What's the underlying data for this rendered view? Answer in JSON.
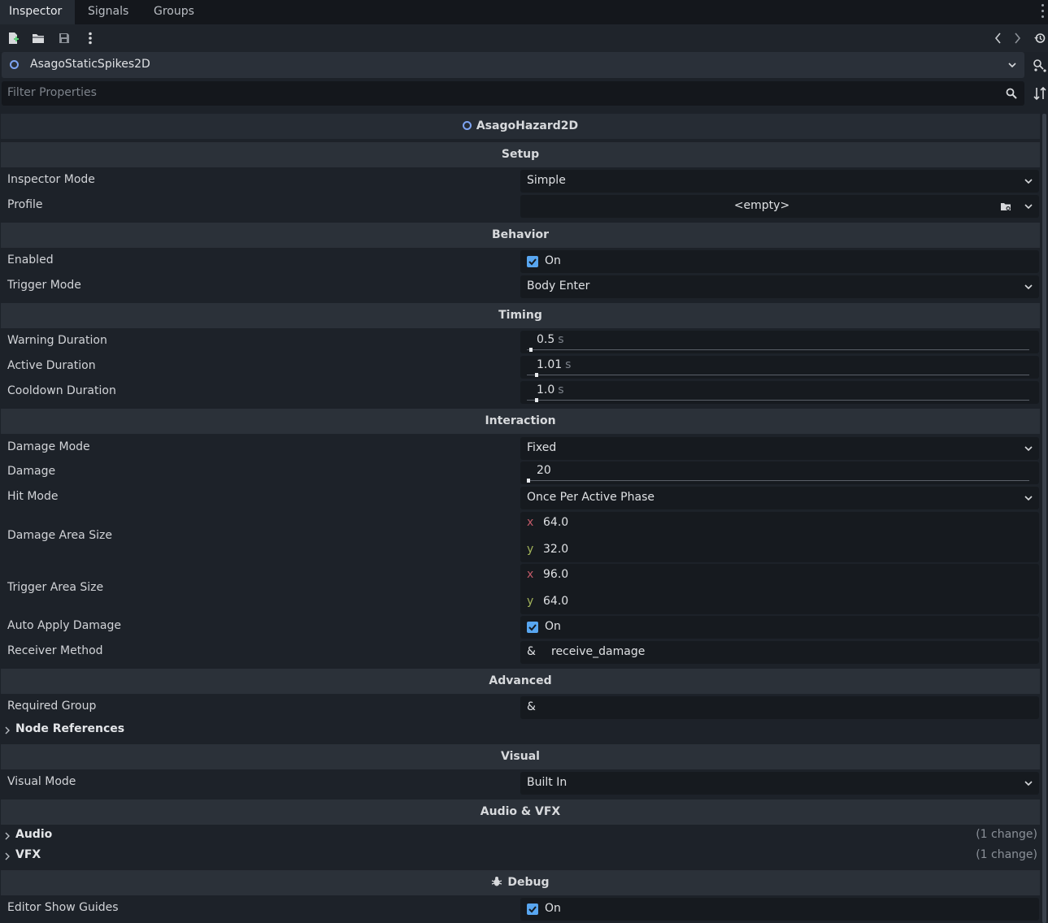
{
  "tabs": [
    {
      "label": "Inspector",
      "active": true
    },
    {
      "label": "Signals",
      "active": false
    },
    {
      "label": "Groups",
      "active": false
    }
  ],
  "toolbar": {
    "icons": [
      "new-resource-icon",
      "open-folder-icon",
      "save-icon",
      "more-icon",
      "history-back-icon",
      "history-forward-icon",
      "history-icon"
    ]
  },
  "selector": {
    "object_name": "AsagoStaticSpikes2D"
  },
  "filter": {
    "placeholder": "Filter Properties"
  },
  "class_header": "AsagoHazard2D",
  "sections": {
    "setup": "Setup",
    "behavior": "Behavior",
    "timing": "Timing",
    "interaction": "Interaction",
    "advanced": "Advanced",
    "visual": "Visual",
    "audio_vfx": "Audio & VFX",
    "debug": "Debug"
  },
  "props": {
    "inspector_mode": {
      "label": "Inspector Mode",
      "value": "Simple"
    },
    "profile": {
      "label": "Profile",
      "value": "<empty>"
    },
    "enabled": {
      "label": "Enabled",
      "value": "On"
    },
    "trigger_mode": {
      "label": "Trigger Mode",
      "value": "Body Enter"
    },
    "warning_duration": {
      "label": "Warning Duration",
      "value": "0.5",
      "unit": "s"
    },
    "active_duration": {
      "label": "Active Duration",
      "value": "1.01",
      "unit": "s"
    },
    "cooldown_duration": {
      "label": "Cooldown Duration",
      "value": "1.0",
      "unit": "s"
    },
    "damage_mode": {
      "label": "Damage Mode",
      "value": "Fixed"
    },
    "damage": {
      "label": "Damage",
      "value": "20"
    },
    "hit_mode": {
      "label": "Hit Mode",
      "value": "Once Per Active Phase"
    },
    "damage_area_size": {
      "label": "Damage Area Size",
      "x": "64.0",
      "y": "32.0"
    },
    "trigger_area_size": {
      "label": "Trigger Area Size",
      "x": "96.0",
      "y": "64.0"
    },
    "auto_apply_damage": {
      "label": "Auto Apply Damage",
      "value": "On"
    },
    "receiver_method": {
      "label": "Receiver Method",
      "prefix": "&",
      "value": "receive_damage"
    },
    "required_group": {
      "label": "Required Group",
      "prefix": "&"
    },
    "visual_mode": {
      "label": "Visual Mode",
      "value": "Built In"
    },
    "editor_show_guides": {
      "label": "Editor Show Guides",
      "value": "On"
    }
  },
  "groups": {
    "node_references": {
      "label": "Node References"
    },
    "audio": {
      "label": "Audio",
      "change": "(1 change)"
    },
    "vfx": {
      "label": "VFX",
      "change": "(1 change)"
    }
  },
  "vector_axes": {
    "x": "x",
    "y": "y"
  },
  "colors": {
    "accent": "#58a6f0",
    "x_axis": "#c25a68",
    "y_axis": "#a2b35a"
  }
}
